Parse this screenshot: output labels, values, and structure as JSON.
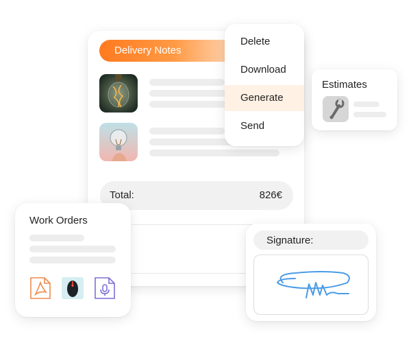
{
  "delivery_notes": {
    "title": "Delivery Notes",
    "total_label": "Total:",
    "total_value": "826€",
    "items": [
      {
        "image": "filament-bulb-photo"
      },
      {
        "image": "lightbulb-photo"
      }
    ]
  },
  "menu": {
    "items": [
      {
        "label": "Delete",
        "active": false
      },
      {
        "label": "Download",
        "active": false
      },
      {
        "label": "Generate",
        "active": true
      },
      {
        "label": "Send",
        "active": false
      }
    ]
  },
  "estimates": {
    "title": "Estimates",
    "icon": "wrench-photo"
  },
  "work_orders": {
    "title": "Work Orders",
    "attachments": [
      {
        "icon": "pdf-icon",
        "color": "#f08a4b"
      },
      {
        "icon": "mouse-photo",
        "color": "#d6eef2"
      },
      {
        "icon": "audio-file-icon",
        "color": "#7b6fd6"
      }
    ]
  },
  "signature": {
    "label": "Signature:",
    "stroke_color": "#4a9be6"
  },
  "colors": {
    "accent": "#ff7a1f",
    "menu_active_bg": "#fff1e4"
  }
}
